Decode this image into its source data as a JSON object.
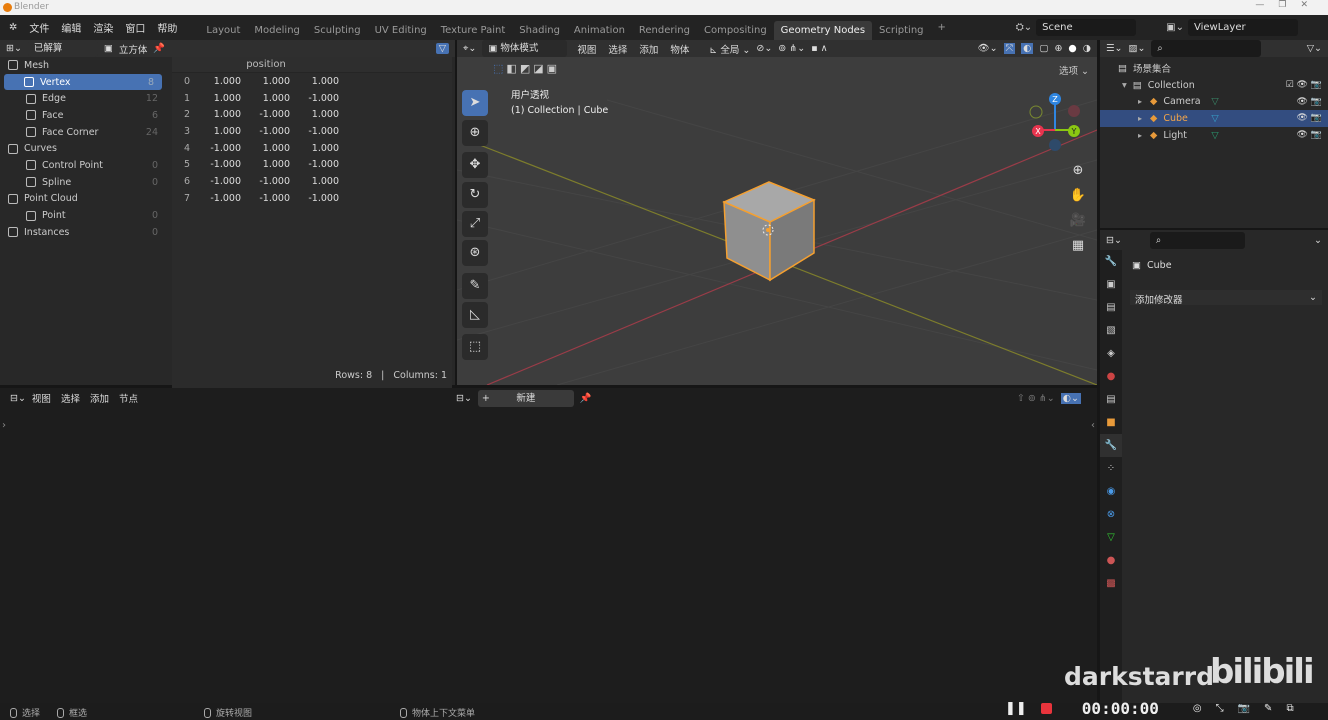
{
  "window": {
    "title": "Blender"
  },
  "menu": [
    "文件",
    "编辑",
    "渲染",
    "窗口",
    "帮助"
  ],
  "workspaces": [
    "Layout",
    "Modeling",
    "Sculpting",
    "UV Editing",
    "Texture Paint",
    "Shading",
    "Animation",
    "Rendering",
    "Compositing",
    "Geometry Nodes",
    "Scripting"
  ],
  "active_workspace": "Geometry Nodes",
  "add_workspace": "+",
  "scene": "Scene",
  "view_layer": "ViewLayer",
  "spreadsheet": {
    "mode": "已解算",
    "object": "立方体",
    "tree": [
      {
        "label": "Mesh",
        "count": "",
        "level": 0,
        "icon": "mesh-icon"
      },
      {
        "label": "Vertex",
        "count": "8",
        "level": 1,
        "icon": "vertex-icon",
        "selected": true
      },
      {
        "label": "Edge",
        "count": "12",
        "level": 1,
        "icon": "edge-icon"
      },
      {
        "label": "Face",
        "count": "6",
        "level": 1,
        "icon": "face-icon"
      },
      {
        "label": "Face Corner",
        "count": "24",
        "level": 1,
        "icon": "face-corner-icon"
      },
      {
        "label": "Curves",
        "count": "",
        "level": 0,
        "icon": "curves-icon"
      },
      {
        "label": "Control Point",
        "count": "0",
        "level": 1,
        "icon": "control-point-icon"
      },
      {
        "label": "Spline",
        "count": "0",
        "level": 1,
        "icon": "spline-icon"
      },
      {
        "label": "Point Cloud",
        "count": "",
        "level": 0,
        "icon": "point-cloud-icon"
      },
      {
        "label": "Point",
        "count": "0",
        "level": 1,
        "icon": "point-icon"
      },
      {
        "label": "Instances",
        "count": "0",
        "level": 0,
        "icon": "instances-icon"
      }
    ],
    "column": "position",
    "rows": [
      [
        "0",
        "1.000",
        "1.000",
        "1.000"
      ],
      [
        "1",
        "1.000",
        "1.000",
        "-1.000"
      ],
      [
        "2",
        "1.000",
        "-1.000",
        "1.000"
      ],
      [
        "3",
        "1.000",
        "-1.000",
        "-1.000"
      ],
      [
        "4",
        "-1.000",
        "1.000",
        "1.000"
      ],
      [
        "5",
        "-1.000",
        "1.000",
        "-1.000"
      ],
      [
        "6",
        "-1.000",
        "-1.000",
        "1.000"
      ],
      [
        "7",
        "-1.000",
        "-1.000",
        "-1.000"
      ]
    ],
    "footer_rows": "Rows: 8",
    "footer_sep": "|",
    "footer_cols": "Columns: 1"
  },
  "viewport": {
    "mode": "物体模式",
    "menus": [
      "视图",
      "选择",
      "添加",
      "物体"
    ],
    "transform": "全局",
    "options": "选项",
    "view_name": "用户透视",
    "info": "(1) Collection | Cube",
    "gizmo": {
      "x": "X",
      "y": "Y",
      "z": "Z"
    }
  },
  "outliner": {
    "root": "场景集合",
    "collection": "Collection",
    "items": [
      {
        "label": "Camera",
        "selected": false
      },
      {
        "label": "Cube",
        "selected": true
      },
      {
        "label": "Light",
        "selected": false
      }
    ]
  },
  "properties": {
    "object": "Cube",
    "add_modifier": "添加修改器"
  },
  "node_editor": {
    "menus": [
      "视图",
      "选择",
      "添加",
      "节点"
    ],
    "new": "新建",
    "plus": "+"
  },
  "status": {
    "select": "选择",
    "box_select": "框选",
    "rotate": "旋转视图",
    "context": "物体上下文菜单"
  },
  "recorder": {
    "time": "00:00:00"
  },
  "watermark": {
    "user": "darkstarrd",
    "brand": "bilibili"
  },
  "colors": {
    "accent": "#4772b3",
    "selection": "#ffa040",
    "x_axis": "#e8344e",
    "y_axis": "#8bc712",
    "z_axis": "#2f86e1"
  }
}
